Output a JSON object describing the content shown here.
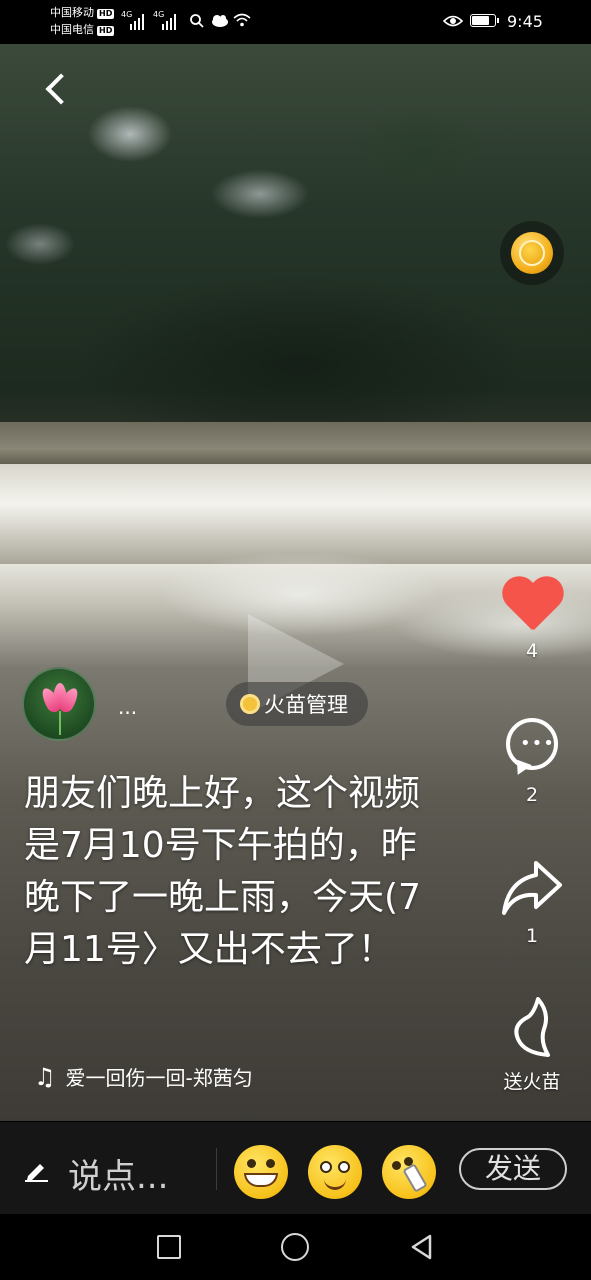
{
  "status_bar": {
    "carrier_1": "中国移动",
    "carrier_2": "中国电信",
    "hd_1": "HD",
    "hd_2": "HD",
    "network_1": "4G",
    "network_2": "4G",
    "time": "9:45",
    "icons": [
      "signal-icon",
      "search-icon",
      "weather-icon",
      "wifi-icon",
      "eye-icon",
      "battery-icon"
    ]
  },
  "video": {
    "play_state": "paused"
  },
  "right_rail": {
    "coin_icon": "gold-coin-icon",
    "likes": {
      "icon": "heart-icon",
      "count": "4",
      "color": "#f5544a"
    },
    "comments": {
      "icon": "comment-icon",
      "count": "2"
    },
    "shares": {
      "icon": "share-icon",
      "count": "1"
    },
    "gift": {
      "icon": "flame-icon",
      "label": "送火苗"
    }
  },
  "author": {
    "name": "...",
    "avatar_icon": "lotus-avatar"
  },
  "badge": {
    "label": "火苗管理",
    "icon": "medal-icon"
  },
  "caption": "朋友们晚上好，这个视频是7月10号下午拍的，昨晚下了一晚上雨，今天(7月11号〉又出不去了！",
  "music": {
    "icon": "music-note-icon",
    "title": "爱一回伤一回-郑茜匀"
  },
  "comment_bar": {
    "placeholder": "说点...",
    "emojis": [
      "grinning-emoji",
      "smiling-emoji",
      "drinking-emoji"
    ],
    "send_label": "发送"
  },
  "nav_bar": {
    "buttons": [
      "recent-apps",
      "home",
      "back"
    ]
  }
}
